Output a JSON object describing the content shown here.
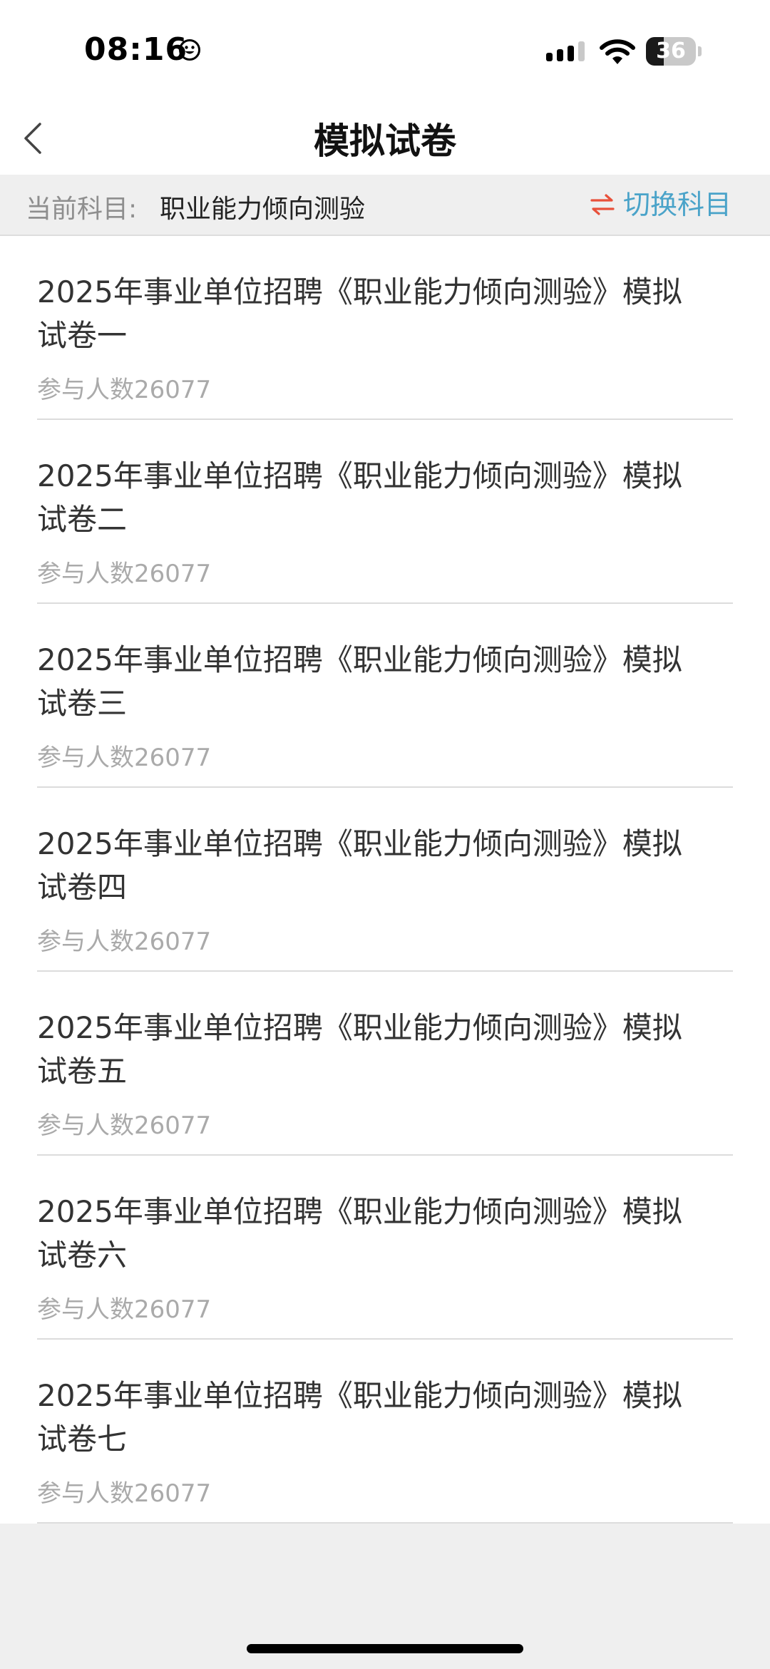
{
  "status_bar": {
    "time": "08:16",
    "battery_level": "36",
    "icons": [
      "smiley-icon",
      "signal-icon",
      "wifi-icon",
      "battery-icon"
    ]
  },
  "nav": {
    "title": "模拟试卷",
    "back_icon": "chevron-left-icon"
  },
  "subject_bar": {
    "label": "当前科目:",
    "value": "职业能力倾向测验",
    "switch_label": "切换科目",
    "switch_icon": "swap-arrows-icon"
  },
  "papers": [
    {
      "title": "2025年事业单位招聘《职业能力倾向测验》模拟试卷一",
      "participants": "参与人数26077"
    },
    {
      "title": "2025年事业单位招聘《职业能力倾向测验》模拟试卷二",
      "participants": "参与人数26077"
    },
    {
      "title": "2025年事业单位招聘《职业能力倾向测验》模拟试卷三",
      "participants": "参与人数26077"
    },
    {
      "title": "2025年事业单位招聘《职业能力倾向测验》模拟试卷四",
      "participants": "参与人数26077"
    },
    {
      "title": "2025年事业单位招聘《职业能力倾向测验》模拟试卷五",
      "participants": "参与人数26077"
    },
    {
      "title": "2025年事业单位招聘《职业能力倾向测验》模拟试卷六",
      "participants": "参与人数26077"
    },
    {
      "title": "2025年事业单位招聘《职业能力倾向测验》模拟试卷七",
      "participants": "参与人数26077"
    }
  ],
  "colors": {
    "accent": "#4aa3c9",
    "swap_icon": "#e8503a",
    "muted_text": "#aaaaaa",
    "background": "#efefef"
  }
}
